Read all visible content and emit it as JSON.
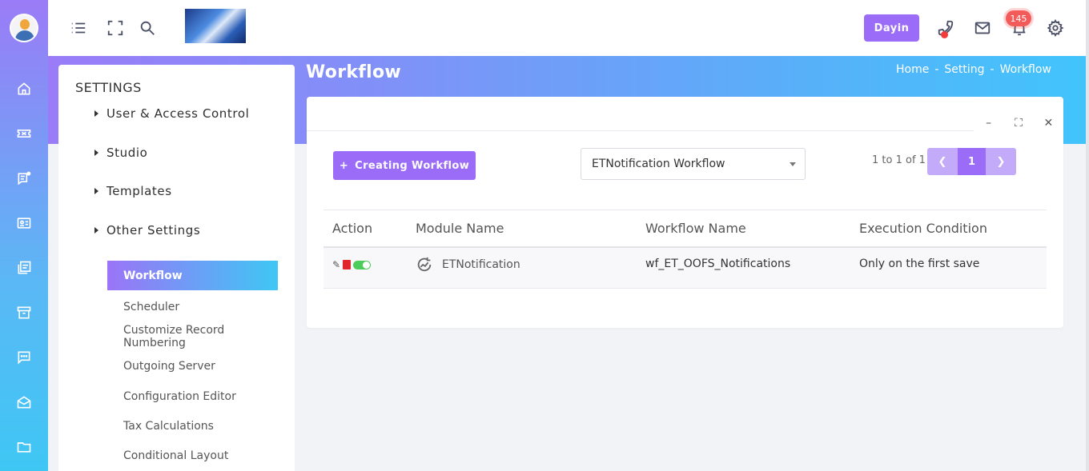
{
  "header": {
    "print_button": "Dayin",
    "notification_count": "145"
  },
  "rail": {
    "icons": [
      "home-icon",
      "ticket-icon",
      "chat-note-icon",
      "contact-card-icon",
      "pdf-stack-icon",
      "archive-icon",
      "message-icon",
      "mail-open-icon",
      "folder-icon"
    ]
  },
  "page": {
    "title": "Workflow",
    "breadcrumb": [
      "Home",
      "-",
      "Setting",
      "-",
      "Workflow"
    ]
  },
  "settings": {
    "title": "SETTINGS",
    "groups": [
      "User & Access Control",
      "Studio",
      "Templates",
      "Other Settings"
    ],
    "items": [
      "Workflow",
      "Scheduler",
      "Customize Record Numbering",
      "Outgoing Server",
      "Configuration Editor",
      "Tax Calculations",
      "Conditional Layout"
    ],
    "active_item": "Workflow"
  },
  "card": {
    "create_button": "Creating Workflow",
    "module_select": "ETNotification Workflow",
    "pager_text": "1 to 1 of 1",
    "current_page": "1",
    "columns": [
      "Action",
      "Module Name",
      "Workflow Name",
      "Execution Condition"
    ],
    "rows": [
      {
        "module": "ETNotification",
        "workflow": "wf_ET_OOFS_Notifications",
        "condition": "Only on the first save",
        "enabled": true
      }
    ]
  },
  "colors": {
    "primary": "#9b6cf7",
    "gradient_start": "#9a7cf8",
    "gradient_end": "#42c4fb",
    "badge": "#f35a5a",
    "toggle_on": "#4ccc5a"
  }
}
